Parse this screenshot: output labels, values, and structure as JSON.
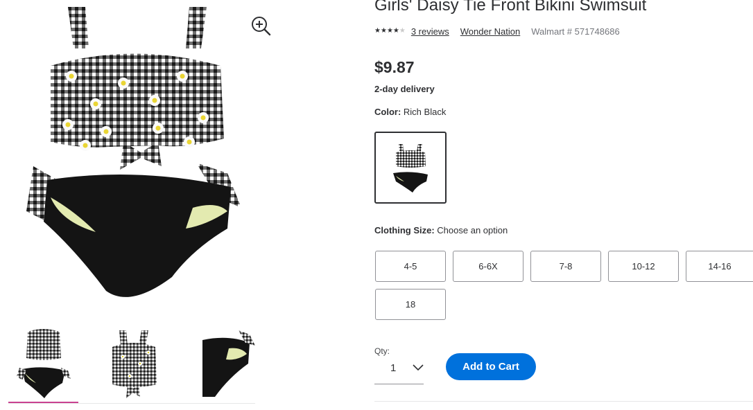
{
  "product": {
    "title": "Girls' Daisy Tie Front Bikini Swimsuit",
    "rating": 4,
    "rating_max": 5,
    "reviews_label": "3 reviews",
    "brand": "Wonder Nation",
    "item_number": "Walmart # 571748686",
    "price": "$9.87",
    "delivery": "2-day delivery"
  },
  "color": {
    "label": "Color:",
    "value": "Rich Black"
  },
  "size": {
    "label": "Clothing Size:",
    "value": "Choose an option",
    "options": [
      "4-5",
      "6-6X",
      "7-8",
      "10-12",
      "14-16",
      "18"
    ]
  },
  "quantity": {
    "label": "Qty:",
    "value": "1"
  },
  "cart": {
    "add_label": "Add to Cart",
    "button_color": "#0071dc"
  },
  "gallery": {
    "active_thumb_color": "#c94290",
    "zoom_icon": "zoom-in-icon"
  }
}
